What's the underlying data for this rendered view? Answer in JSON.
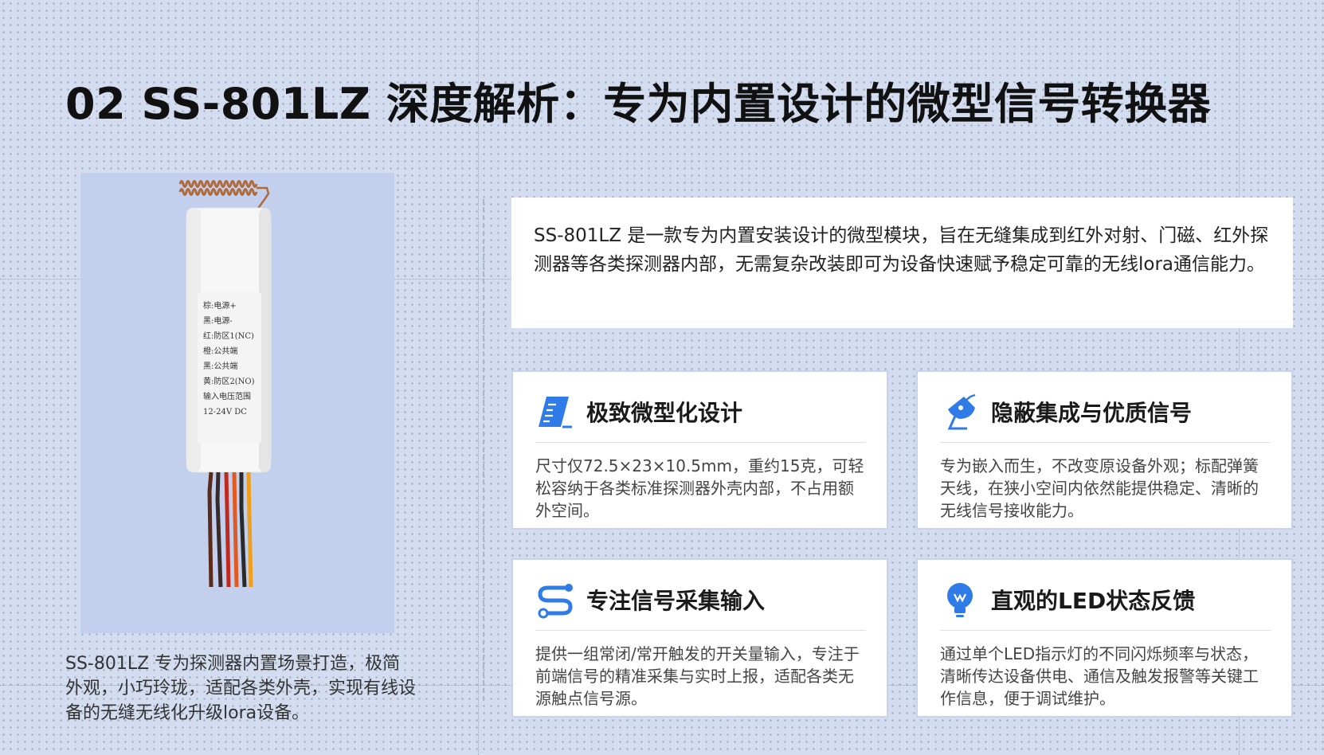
{
  "page": {
    "title": "02 SS-801LZ 深度解析：专为内置设计的微型信号转换器"
  },
  "product": {
    "label_lines": [
      "棕:电源+",
      "黑:电源-",
      "红:防区1(NC)",
      "橙:公共端",
      "黑:公共端",
      "黄:防区2(NO)",
      "输入电压范围",
      "12-24V DC"
    ],
    "caption": "SS-801LZ 专为探测器内置场景打造，极简外观，小巧玲珑，适配各类外壳，实现有线设备的无缝无线化升级lora设备。"
  },
  "intro": {
    "text": "SS-801LZ 是一款专为内置安装设计的微型模块，旨在无缝集成到红外对射、门磁、红外探测器等各类探测器内部，无需复杂改装即可为设备快速赋予稳定可靠的无线lora通信能力。"
  },
  "features": [
    {
      "icon": "ruler-icon",
      "title": "极致微型化设计",
      "body": "尺寸仅72.5×23×10.5mm，重约15克，可轻松容纳于各类标准探测器外壳内部，不占用额外空间。"
    },
    {
      "icon": "satellite-dish-icon",
      "title": "隐蔽集成与优质信号",
      "body": "专为嵌入而生，不改变原设备外观；标配弹簧天线，在狭小空间内依然能提供稳定、清晰的无线信号接收能力。"
    },
    {
      "icon": "path-icon",
      "title": "专注信号采集输入",
      "body": "提供一组常闭/常开触发的开关量输入，专注于前端信号的精准采集与实时上报，适配各类无源触点信号源。"
    },
    {
      "icon": "lightbulb-icon",
      "title": "直观的LED状态反馈",
      "body": "通过单个LED指示灯的不同闪烁频率与状态，清晰传达设备供电、通信及触发报警等关键工作信息，便于调试维护。"
    }
  ],
  "colors": {
    "accent": "#2f7be8",
    "background": "#d3ddef",
    "panel": "#c2d0ee"
  }
}
